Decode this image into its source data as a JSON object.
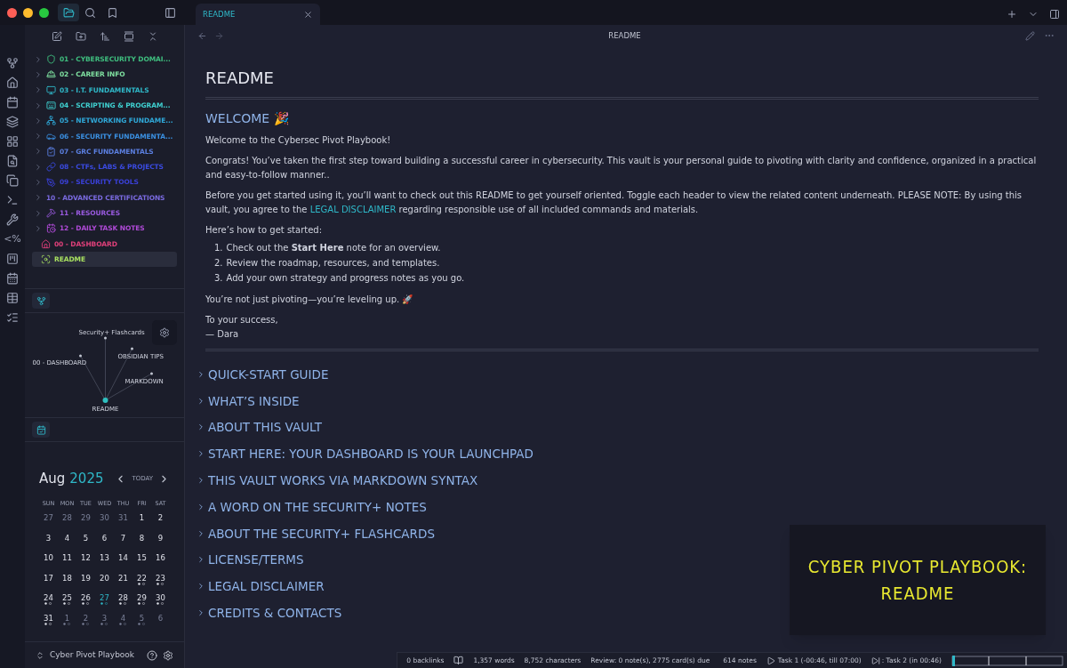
{
  "tab": {
    "title": "README",
    "selected": true
  },
  "nav_title": "README",
  "tree": [
    {
      "label": "01 - CYBERSECURITY DOMAI...",
      "kind": "folder",
      "color": "#3fbf7f",
      "selected": false
    },
    {
      "label": "02 - CAREER INFO",
      "kind": "folder",
      "color": "#7fe0a0",
      "selected": false
    },
    {
      "label": "03 - I.T. FUNDAMENTALS",
      "kind": "folder",
      "color": "#2fb8c8",
      "selected": false
    },
    {
      "label": "04 - SCRIPTING & PROGRAM...",
      "kind": "folder",
      "color": "#3fd0d0",
      "selected": false
    },
    {
      "label": "05 - NETWORKING FUNDAME...",
      "kind": "folder",
      "color": "#2fa8d8",
      "selected": false
    },
    {
      "label": "06 - SECURITY FUNDAMENTA...",
      "kind": "folder",
      "color": "#3a8fe0",
      "selected": false
    },
    {
      "label": "07 - GRC FUNDAMENTALS",
      "kind": "folder",
      "color": "#5b7fe0",
      "selected": false
    },
    {
      "label": "08 - CTFs, LABS & PROJECTS",
      "kind": "folder",
      "color": "#3a4ae0",
      "selected": false
    },
    {
      "label": "09 - SECURITY TOOLS",
      "kind": "folder",
      "color": "#3a40d8",
      "selected": false
    },
    {
      "label": "10 - ADVANCED CERTIFICATIONS",
      "kind": "folder",
      "color": "#7a6ae0",
      "selected": false
    },
    {
      "label": "11 - RESOURCES",
      "kind": "folder",
      "color": "#9a5ae0",
      "selected": false
    },
    {
      "label": "12 - DAILY TASK NOTES",
      "kind": "folder",
      "color": "#b04ad8",
      "selected": false
    },
    {
      "label": "00 - DASHBOARD",
      "kind": "file",
      "color": "#e0407a",
      "selected": false
    },
    {
      "label": "README",
      "kind": "file",
      "color": "#a8e060",
      "selected": true
    }
  ],
  "graph": {
    "nodes": [
      {
        "label": "Security+ Flashcards"
      },
      {
        "label": "OBSIDIAN TIPS"
      },
      {
        "label": "00 - DASHBOARD"
      },
      {
        "label": "MARKDOWN"
      },
      {
        "label": "README"
      }
    ]
  },
  "calendar": {
    "month": "Aug",
    "year": "2025",
    "today_button": "TODAY",
    "weekdays": [
      "SUN",
      "MON",
      "TUE",
      "WED",
      "THU",
      "FRI",
      "SAT"
    ],
    "weeks": [
      [
        {
          "day": "27",
          "muted": true,
          "today": false,
          "dots": false
        },
        {
          "day": "28",
          "muted": true,
          "today": false,
          "dots": false
        },
        {
          "day": "29",
          "muted": true,
          "today": false,
          "dots": false
        },
        {
          "day": "30",
          "muted": true,
          "today": false,
          "dots": false
        },
        {
          "day": "31",
          "muted": true,
          "today": false,
          "dots": false
        },
        {
          "day": "1",
          "muted": false,
          "today": false,
          "dots": false
        },
        {
          "day": "2",
          "muted": false,
          "today": false,
          "dots": false
        }
      ],
      [
        {
          "day": "3",
          "muted": false,
          "today": false,
          "dots": false
        },
        {
          "day": "4",
          "muted": false,
          "today": false,
          "dots": false
        },
        {
          "day": "5",
          "muted": false,
          "today": false,
          "dots": false
        },
        {
          "day": "6",
          "muted": false,
          "today": false,
          "dots": false
        },
        {
          "day": "7",
          "muted": false,
          "today": false,
          "dots": false
        },
        {
          "day": "8",
          "muted": false,
          "today": false,
          "dots": false
        },
        {
          "day": "9",
          "muted": false,
          "today": false,
          "dots": false
        }
      ],
      [
        {
          "day": "10",
          "muted": false,
          "today": false,
          "dots": false
        },
        {
          "day": "11",
          "muted": false,
          "today": false,
          "dots": false
        },
        {
          "day": "12",
          "muted": false,
          "today": false,
          "dots": false
        },
        {
          "day": "13",
          "muted": false,
          "today": false,
          "dots": false
        },
        {
          "day": "14",
          "muted": false,
          "today": false,
          "dots": false
        },
        {
          "day": "15",
          "muted": false,
          "today": false,
          "dots": false
        },
        {
          "day": "16",
          "muted": false,
          "today": false,
          "dots": false
        }
      ],
      [
        {
          "day": "17",
          "muted": false,
          "today": false,
          "dots": false
        },
        {
          "day": "18",
          "muted": false,
          "today": false,
          "dots": false
        },
        {
          "day": "19",
          "muted": false,
          "today": false,
          "dots": false
        },
        {
          "day": "20",
          "muted": false,
          "today": false,
          "dots": false
        },
        {
          "day": "21",
          "muted": false,
          "today": false,
          "dots": false
        },
        {
          "day": "22",
          "muted": false,
          "today": false,
          "dots": true
        },
        {
          "day": "23",
          "muted": false,
          "today": false,
          "dots": true
        }
      ],
      [
        {
          "day": "24",
          "muted": false,
          "today": false,
          "dots": true
        },
        {
          "day": "25",
          "muted": false,
          "today": false,
          "dots": true
        },
        {
          "day": "26",
          "muted": false,
          "today": false,
          "dots": true
        },
        {
          "day": "27",
          "muted": false,
          "today": true,
          "dots": true
        },
        {
          "day": "28",
          "muted": false,
          "today": false,
          "dots": true
        },
        {
          "day": "29",
          "muted": false,
          "today": false,
          "dots": true
        },
        {
          "day": "30",
          "muted": false,
          "today": false,
          "dots": true
        }
      ],
      [
        {
          "day": "31",
          "muted": false,
          "today": false,
          "dots": true
        },
        {
          "day": "1",
          "muted": true,
          "today": false,
          "dots": true
        },
        {
          "day": "2",
          "muted": true,
          "today": false,
          "dots": true
        },
        {
          "day": "3",
          "muted": true,
          "today": false,
          "dots": true
        },
        {
          "day": "4",
          "muted": true,
          "today": false,
          "dots": true
        },
        {
          "day": "5",
          "muted": true,
          "today": false,
          "dots": true
        },
        {
          "day": "6",
          "muted": true,
          "today": false,
          "dots": false
        }
      ]
    ]
  },
  "vault_name": "Cyber Pivot Playbook",
  "note": {
    "title": "README",
    "welcome": "WELCOME 🎉",
    "paragraphs": [
      "Welcome to the Cybersec Pivot Playbook!",
      "Congrats! You’ve taken the first step toward building a successful career in cybersecurity. This vault is your personal guide to pivoting with clarity and confidence, organized in a practical and easy-to-follow manner.."
    ],
    "disclaimer_before": "Before you get started using it, you’ll want to check out this README to get yourself oriented. Toggle each header to view the related content underneath. PLEASE NOTE: By using this vault, you agree to the",
    "disclaimer_link": "LEGAL DISCLAIMER",
    "disclaimer_after": "regarding responsible use of all included commands and materials.",
    "list_intro": "Here’s how to get started:",
    "steps": [
      "Check out the **Start Here** note for an overview.",
      "Review the roadmap, resources, and templates.",
      "Add your own strategy and progress notes as you go."
    ],
    "list_markers": [
      "1.",
      "2.",
      "3."
    ],
    "closing": "You’re not just pivoting—you’re leveling up. 🚀",
    "signoff": [
      "To your success,",
      "— Dara"
    ],
    "sections": [
      "QUICK-START GUIDE",
      "WHAT’S INSIDE",
      "ABOUT THIS VAULT",
      "START HERE: YOUR DASHBOARD IS YOUR LAUNCHPAD",
      "THIS VAULT WORKS VIA MARKDOWN SYNTAX",
      "A WORD ON THE SECURITY+ NOTES",
      "ABOUT THE SECURITY+ FLASHCARDS",
      "LICENSE/TERMS",
      "LEGAL DISCLAIMER",
      "CREDITS & CONTACTS"
    ],
    "banner": [
      "CYBER PIVOT PLAYBOOK:",
      "README"
    ]
  },
  "status": {
    "backlinks": "0 backlinks",
    "words": "1,357 words",
    "characters": "8,752 characters",
    "review": "Review: 0 note(s), 2775 card(s) due",
    "notes": "614 notes",
    "task_current": "Task 1 (-00:46, till 07:00)",
    "task_next": ": Task 2 (in 00:46)"
  },
  "ribbon_template": "<%"
}
